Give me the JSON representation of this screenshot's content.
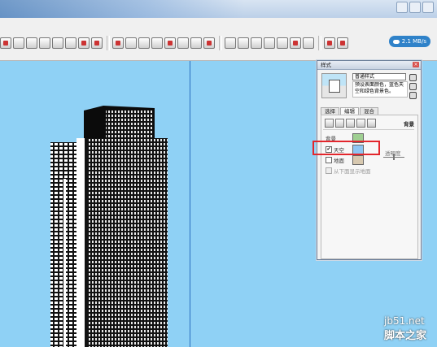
{
  "speed_badge": "2.1 MB/s",
  "panel": {
    "title": "样式",
    "style_name": "普通样式",
    "style_description": "预设表面颜色，蓝色天空和绿色背景色。",
    "tabs": [
      {
        "label": "选择"
      },
      {
        "label": "编辑"
      },
      {
        "label": "混合"
      }
    ],
    "section_heading": "背景",
    "rows": {
      "background_label": "背景",
      "sky_label": "天空",
      "ground_label": "地面",
      "transparency_label": "透明度",
      "show_ground_from_below_label": "从下面显示地面"
    },
    "colors": {
      "background": "#9fcf92",
      "sky": "#8dc5f2",
      "ground": "#d8c9b0"
    },
    "sky_checked": true,
    "ground_checked": false
  },
  "watermark": {
    "site": "jb51.net",
    "name": "脚本之家"
  },
  "colors": {
    "viewport_sky": "#8fd1f5",
    "axis_blue": "#2a6ebf",
    "highlight_red": "#e3262c"
  }
}
